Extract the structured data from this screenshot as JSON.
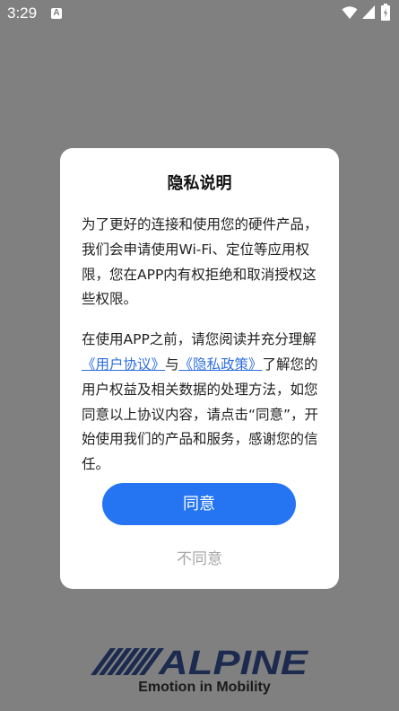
{
  "status_bar": {
    "time": "3:29",
    "app_icon_letter": "A"
  },
  "dialog": {
    "title": "隐私说明",
    "paragraph1": "为了更好的连接和使用您的硬件产品，我们会申请使用Wi-Fi、定位等应用权限，您在APP内有权拒绝和取消授权这些权限。",
    "paragraph2_before": "在使用APP之前，请您阅读并充分理解",
    "user_agreement_link": "《用户协议》",
    "paragraph2_and": "与",
    "privacy_policy_link": "《隐私政策》",
    "paragraph2_after": "了解您的用户权益及相关数据的处理方法，如您同意以上协议内容，请点击“同意”，开始使用我们的产品和服务，感谢您的信任。",
    "agree_label": "同意",
    "disagree_label": "不同意"
  },
  "brand": {
    "logo_text": "ALPINE",
    "tagline": "Emotion in Mobility"
  }
}
